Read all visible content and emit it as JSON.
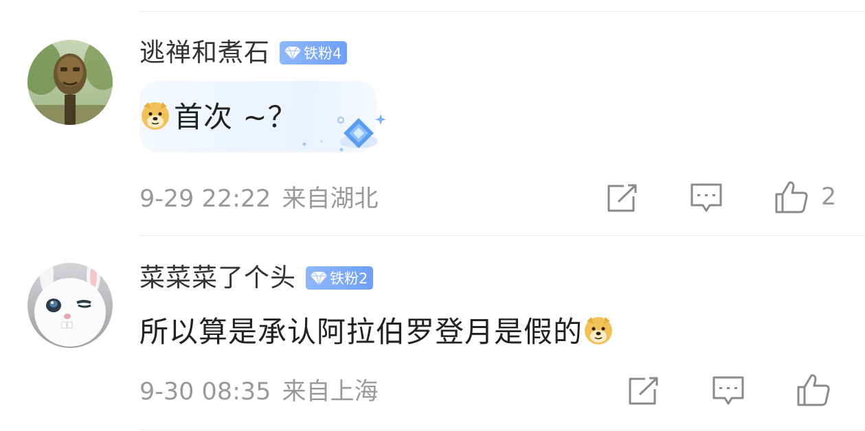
{
  "comments": [
    {
      "username": "逃禅和煮石",
      "badge": "铁粉4",
      "emoji_prefix": "doge-emoji",
      "text": "首次 ~？",
      "time": "9-29 22:22",
      "location": "来自湖北",
      "likes": "2",
      "has_vip_bubble": true
    },
    {
      "username": "菜菜菜了个头",
      "badge": "铁粉2",
      "text": "所以算是承认阿拉伯罗登月是假的",
      "emoji_suffix": "doge-emoji",
      "time": "9-30 08:35",
      "location": "来自上海",
      "likes": "",
      "has_vip_bubble": false
    }
  ],
  "icons": {
    "repost": "share-icon",
    "reply": "comment-icon",
    "like": "thumbs-up-icon",
    "badge": "diamond-icon"
  },
  "colors": {
    "badge_bg": "#7fa9f8",
    "meta_text": "#999999",
    "bubble_bg": "#eef5ff"
  }
}
